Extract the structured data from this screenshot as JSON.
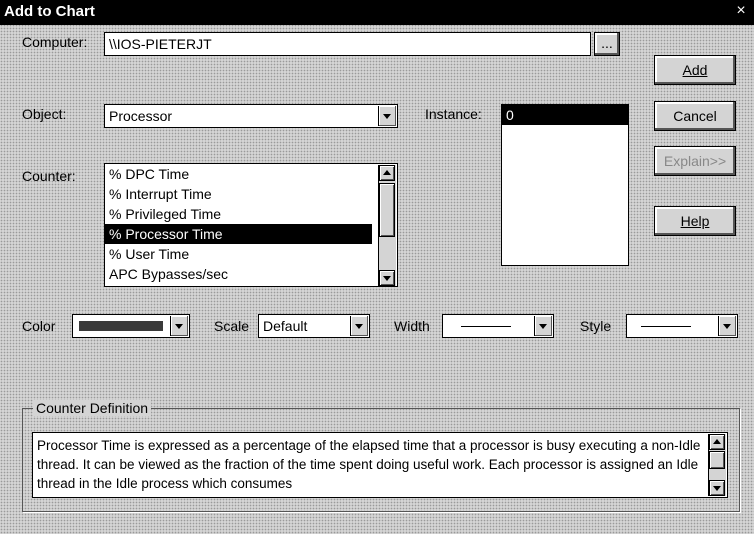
{
  "window": {
    "title": "Add to Chart",
    "close_glyph": "×"
  },
  "computer": {
    "label": "Computer:",
    "value": "\\\\IOS-PIETERJT",
    "browse_label": "..."
  },
  "object": {
    "label": "Object:",
    "selected": "Processor"
  },
  "instance": {
    "label": "Instance:",
    "items": [
      "0"
    ],
    "selected_index": 0
  },
  "counter": {
    "label": "Counter:",
    "items": [
      "% DPC Time",
      "% Interrupt Time",
      "% Privileged Time",
      "% Processor Time",
      "% User Time",
      "APC Bypasses/sec"
    ],
    "selected_index": 3
  },
  "buttons": {
    "add": "Add",
    "cancel": "Cancel",
    "explain": "Explain>>",
    "help": "Help"
  },
  "options": {
    "color_label": "Color",
    "color_value": "#3a3a3a",
    "scale_label": "Scale",
    "scale_value": "Default",
    "width_label": "Width",
    "style_label": "Style"
  },
  "definition": {
    "group_label": "Counter Definition",
    "text": "Processor Time is expressed as a percentage of the elapsed time that a processor is busy executing a non-Idle thread.  It can be viewed as the fraction of the time spent doing useful work.  Each processor is assigned an Idle thread in the Idle process which consumes"
  }
}
